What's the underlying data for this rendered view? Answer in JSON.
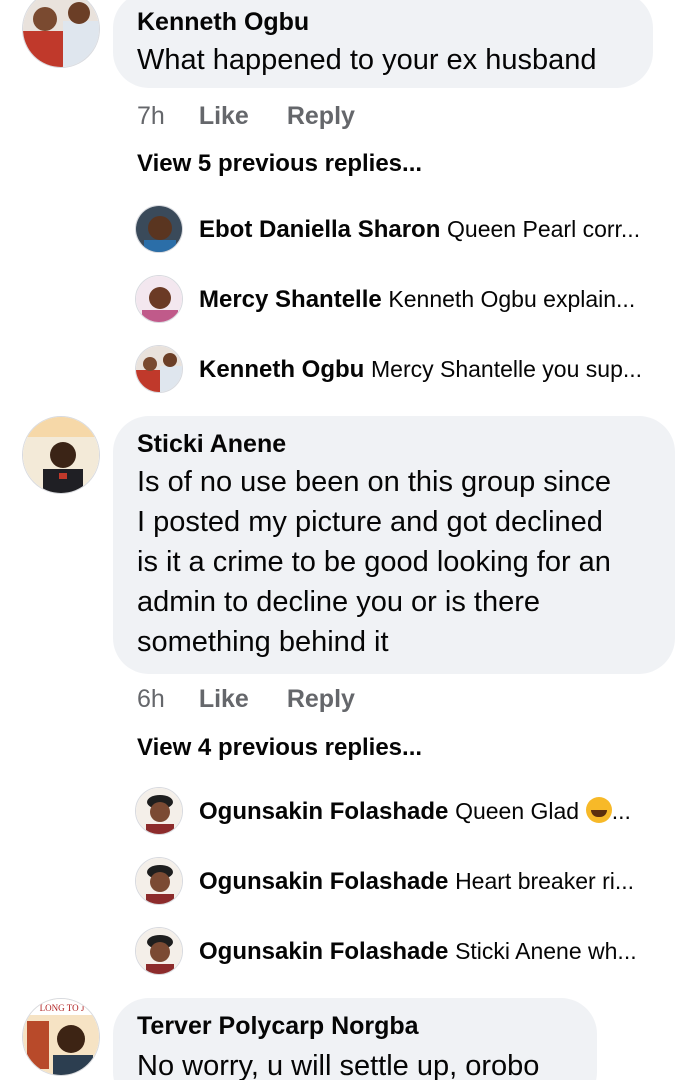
{
  "comments": [
    {
      "author": "Kenneth Ogbu",
      "text": "What happened to your ex husband",
      "time": "7h",
      "like": "Like",
      "reply": "Reply",
      "view_previous": "View 5 previous replies...",
      "replies": [
        {
          "author": "Ebot Daniella Sharon",
          "text": "Queen Pearl corr..."
        },
        {
          "author": "Mercy Shantelle",
          "text": "Kenneth Ogbu explain..."
        },
        {
          "author": "Kenneth Ogbu",
          "text": "Mercy Shantelle you sup..."
        }
      ]
    },
    {
      "author": "Sticki Anene",
      "text_lines": [
        "Is of no use been on this group since",
        "I posted my picture and got declined",
        "is it a crime to be good looking for an",
        "admin to decline you or is there",
        "something behind it"
      ],
      "time": "6h",
      "like": "Like",
      "reply": "Reply",
      "view_previous": "View 4 previous replies...",
      "replies": [
        {
          "author": "Ogunsakin Folashade",
          "text": "Queen Glad",
          "suffix": "..."
        },
        {
          "author": "Ogunsakin Folashade",
          "text": "Heart breaker ri..."
        },
        {
          "author": "Ogunsakin Folashade",
          "text": "Sticki Anene wh..."
        }
      ]
    },
    {
      "author": "Terver Polycarp Norgba",
      "text": "No worry, u will settle up, orobo",
      "avatar_banner": "LONG TO J"
    }
  ],
  "icons": {
    "laughing": "face-with-tears-of-joy-icon"
  },
  "colors": {
    "bubble": "#f0f2f5",
    "meta": "#65676b",
    "text": "#050505"
  }
}
